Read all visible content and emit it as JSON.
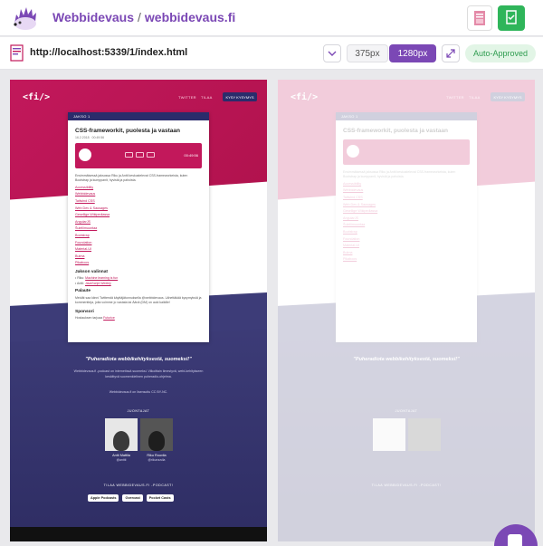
{
  "header": {
    "project": "Webbidevaus",
    "separator": "/",
    "repo": "webbidevaus.fi"
  },
  "toolbar": {
    "url": "http://localhost:5339/1/index.html",
    "viewport_small": "375px",
    "viewport_large": "1280px",
    "status": "Auto-Approved"
  },
  "site": {
    "brand": "<fi/>",
    "nav": [
      "TWITTER",
      "TILAA"
    ],
    "cta": "KYSY KYSYMYS",
    "episode_label": "JAKSO 1",
    "title": "CSS-frameworkit, puolesta ja vastaan",
    "date": "16.2.2018",
    "duration": "00:49:56",
    "time": "00:49:56",
    "intro": "Ensimmäisessä jaksossa Riku ja Antti keskustelevat CSS-frameworkeista, kuten Bootstrap ja kumppanit, hyvistä ja pahoista.",
    "links": [
      "Accessibility",
      "Webbidevaus",
      "Tailwind CSS",
      "Web Dev & Sausages",
      "Gesellige Wikipediassa",
      "AngularJS",
      "Šuleliimuuntaa",
      "Bootstrap",
      "Foundation",
      "Material-UI",
      "Bulma",
      "Pikaboos"
    ],
    "picks_h": "Jakson valinnat",
    "pick1_prefix": "Riku:",
    "pick1_link": "Machine learning is fun",
    "pick2_prefix": "Antti:",
    "pick2_link": "JavaScript Weekly",
    "feedback_h": "Palaute",
    "feedback": "Meidät saa kiinni Twitterstä käyttäjätunnuksella @webbidevaus. Lähettäkää kysymyksiä ja kommentteja, joita voimme jo vastata tai Äänä (DM) on auki kaikille!",
    "sponsor_h": "Sponsori",
    "sponsor_prefix": "Hostauksen tarjoaa",
    "sponsor_link": "Futurice",
    "quote": "\"Puheradiota webbikehityksestä, suomeksi!\"",
    "about": "Webbidevaus.fi -podcast on internetissä suomeksi. Viikoittain ilmestyvä, webi-kehitykseen keskittyvä suomenkielinen puheradio-ohjelma.",
    "license": "Webbidevaus.fi on lisensoitu CC BY-NC.",
    "hosts_h": "JUONTAJAT",
    "host1_name": "Antti Mattila",
    "host1_handle": "@anttti",
    "host2_name": "Riku Rouvila",
    "host2_handle": "@rikurouvila",
    "subscribe_h": "TILAA WEBBIDEVAUS.FI -PODCAST!",
    "podcasts": [
      "Apple Podcasts",
      "Overcast",
      "Pocket Casts"
    ]
  },
  "colors": {
    "accent": "#7b48b5",
    "approved_green": "#2fb55a",
    "site_pink": "#c2185b",
    "site_navy": "#2a2c6b"
  },
  "icons": [
    "hedgehog-icon",
    "page-icon",
    "chevron-down-icon",
    "expand-icon",
    "chat-icon"
  ]
}
